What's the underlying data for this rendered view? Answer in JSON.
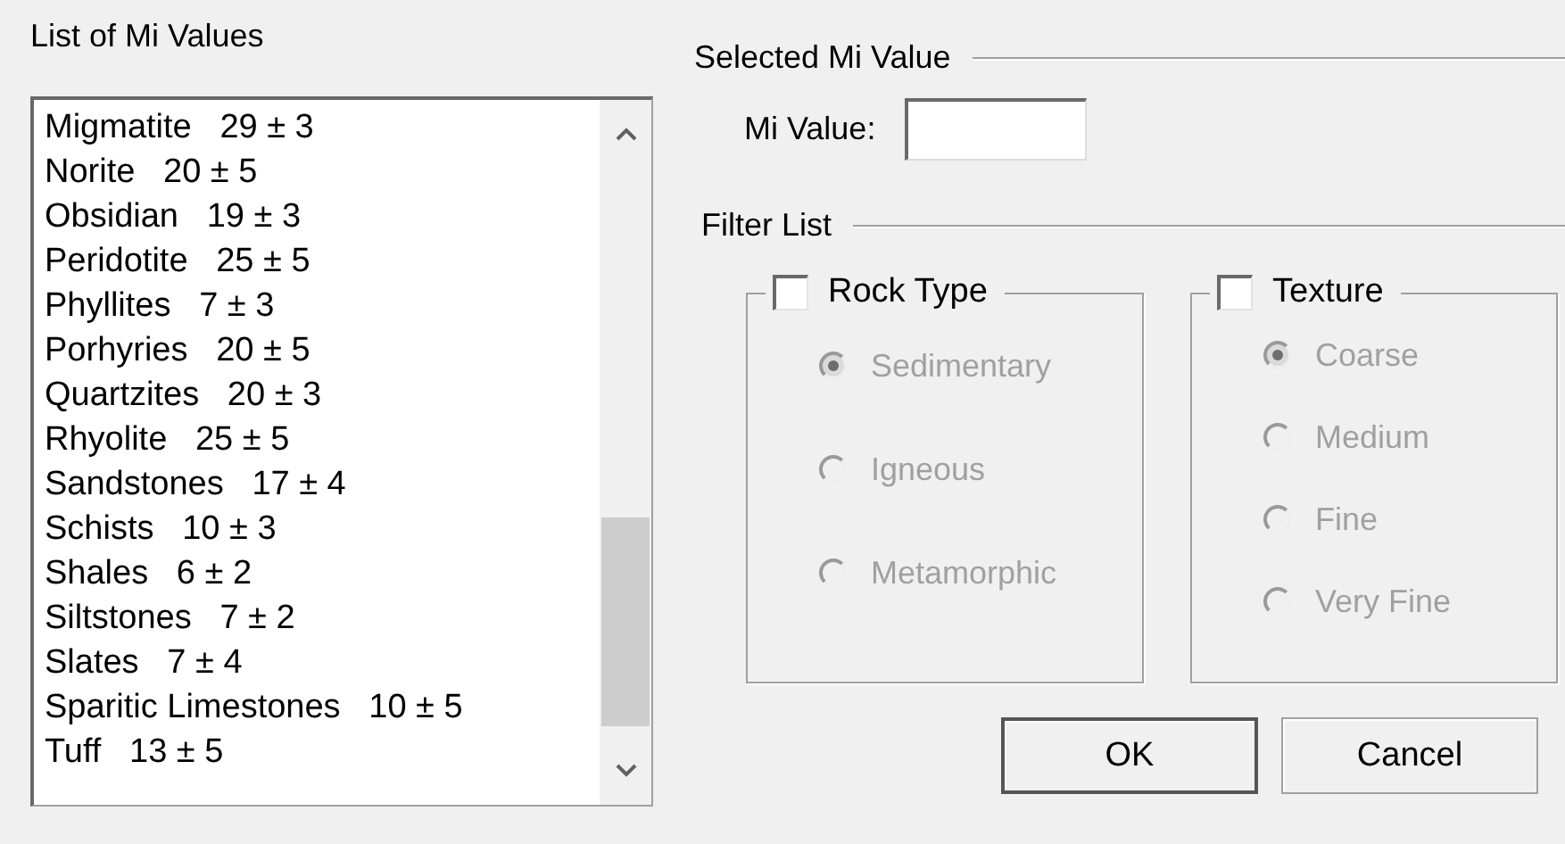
{
  "list_panel": {
    "label": "List of Mi Values",
    "items": [
      {
        "name": "Migmatite",
        "value": "29 ± 3"
      },
      {
        "name": "Norite",
        "value": "20 ± 5"
      },
      {
        "name": "Obsidian",
        "value": "19 ± 3"
      },
      {
        "name": "Peridotite",
        "value": "25 ± 5"
      },
      {
        "name": "Phyllites",
        "value": "7 ± 3"
      },
      {
        "name": "Porhyries",
        "value": "20 ± 5"
      },
      {
        "name": "Quartzites",
        "value": "20 ± 3"
      },
      {
        "name": "Rhyolite",
        "value": "25 ± 5"
      },
      {
        "name": "Sandstones",
        "value": "17 ± 4"
      },
      {
        "name": "Schists",
        "value": "10 ± 3"
      },
      {
        "name": "Shales",
        "value": "6 ± 2"
      },
      {
        "name": "Siltstones",
        "value": "7 ± 2"
      },
      {
        "name": "Slates",
        "value": "7 ± 4"
      },
      {
        "name": "Sparitic Limestones",
        "value": "10 ± 5"
      },
      {
        "name": "Tuff",
        "value": "13 ± 5"
      }
    ]
  },
  "selected_section": {
    "title": "Selected Mi Value",
    "field_label": "Mi Value:"
  },
  "filter_section": {
    "title": "Filter List",
    "groups": [
      {
        "label": "Rock Type",
        "checked": false,
        "options": [
          {
            "label": "Sedimentary",
            "selected": true,
            "disabled": true
          },
          {
            "label": "Igneous",
            "selected": false,
            "disabled": true
          },
          {
            "label": "Metamorphic",
            "selected": false,
            "disabled": true
          }
        ]
      },
      {
        "label": "Texture",
        "checked": false,
        "options": [
          {
            "label": "Coarse",
            "selected": true,
            "disabled": true
          },
          {
            "label": "Medium",
            "selected": false,
            "disabled": true
          },
          {
            "label": "Fine",
            "selected": false,
            "disabled": true
          },
          {
            "label": "Very Fine",
            "selected": false,
            "disabled": true
          }
        ]
      }
    ]
  },
  "buttons": [
    "OK",
    "Cancel"
  ]
}
